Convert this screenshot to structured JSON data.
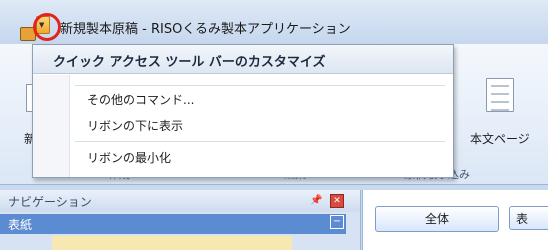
{
  "window": {
    "title": "新規製本原稿 - RISOくるみ製本アプリケーション"
  },
  "ribbon": {
    "left_label_partial": "新規",
    "right_label_partial": "本文ページ",
    "group_labels": [
      "作成",
      "編集",
      "原稿取り込み"
    ]
  },
  "qat_menu": {
    "header": "クイック アクセス ツール バーのカスタマイズ",
    "items": [
      "その他のコマンド...",
      "リボンの下に表示",
      "リボンの最小化"
    ]
  },
  "navigation": {
    "title": "ナビゲーション",
    "selected_item": "表紙"
  },
  "right_pane": {
    "tab_all": "全体",
    "tab_partial": "表"
  },
  "colors": {
    "highlight_circle": "#e3241c",
    "nav_selected": "#5b8bd0"
  }
}
